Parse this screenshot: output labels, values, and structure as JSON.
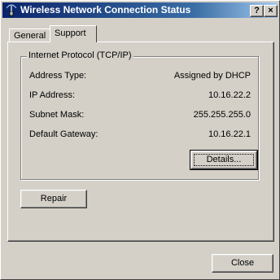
{
  "window": {
    "title": "Wireless Network Connection Status",
    "help_label": "?",
    "close_glyph": "×"
  },
  "tabs": [
    {
      "label": "General",
      "selected": false
    },
    {
      "label": "Support",
      "selected": true
    }
  ],
  "group": {
    "title": "Internet Protocol (TCP/IP)",
    "rows": [
      {
        "label": "Address Type:",
        "value": "Assigned by DHCP"
      },
      {
        "label": "IP Address:",
        "value": "10.16.22.2"
      },
      {
        "label": "Subnet Mask:",
        "value": "255.255.255.0"
      },
      {
        "label": "Default Gateway:",
        "value": "10.16.22.1"
      }
    ],
    "details_button": {
      "label": "Details..."
    }
  },
  "repair_button": {
    "label": "Repair"
  },
  "close_button": {
    "label": "Close"
  },
  "icons": {
    "title_icon": "network-antenna-icon"
  }
}
